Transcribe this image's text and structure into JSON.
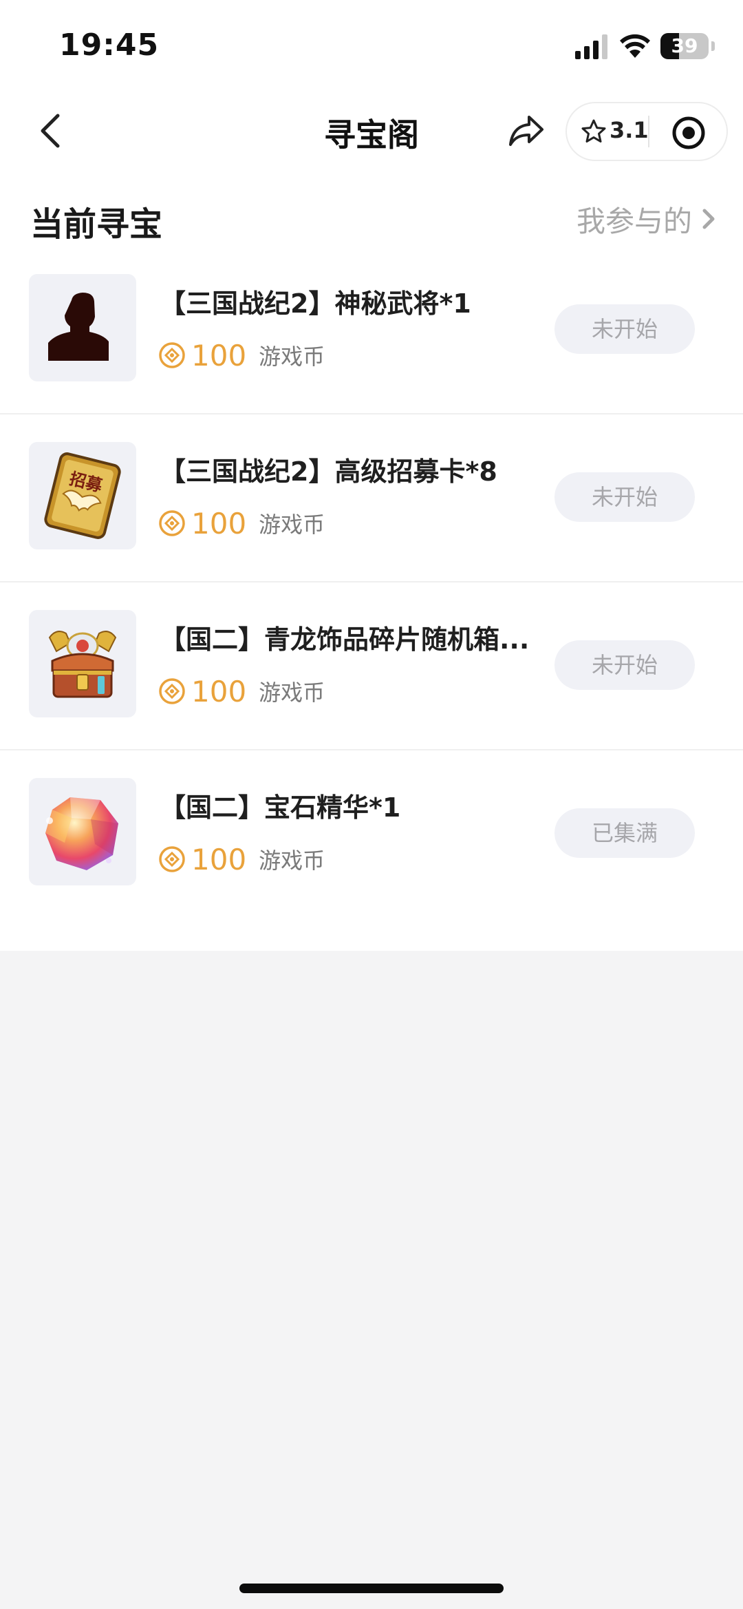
{
  "status_bar": {
    "time": "19:45",
    "battery_level": "39",
    "battery_fraction": 0.39,
    "icons": [
      "signal-icon",
      "wifi-icon",
      "battery-icon"
    ]
  },
  "nav": {
    "title": "寻宝阁",
    "rating": "3.1",
    "icons": [
      "chevron-left-icon",
      "share-icon",
      "star-icon",
      "target-icon"
    ]
  },
  "section": {
    "title": "当前寻宝",
    "my_participation": "我参与的"
  },
  "items": [
    {
      "title": "【三国战纪2】神秘武将*1",
      "price": "100",
      "unit": "游戏币",
      "status": "未开始",
      "icon": "mystery-general-icon"
    },
    {
      "title": "【三国战纪2】高级招募卡*8",
      "price": "100",
      "unit": "游戏币",
      "status": "未开始",
      "icon": "recruit-card-icon",
      "icon_text": "招募"
    },
    {
      "title": "【国二】青龙饰品碎片随机箱...",
      "price": "100",
      "unit": "游戏币",
      "status": "未开始",
      "icon": "treasure-chest-icon"
    },
    {
      "title": "【国二】宝石精华*1",
      "price": "100",
      "unit": "游戏币",
      "status": "已集满",
      "icon": "gem-icon"
    }
  ],
  "colors": {
    "price": "#e9a23b",
    "status_button_bg": "#f0f1f6",
    "status_button_text": "#a6a6aa",
    "page_bg": "#f4f4f5"
  }
}
